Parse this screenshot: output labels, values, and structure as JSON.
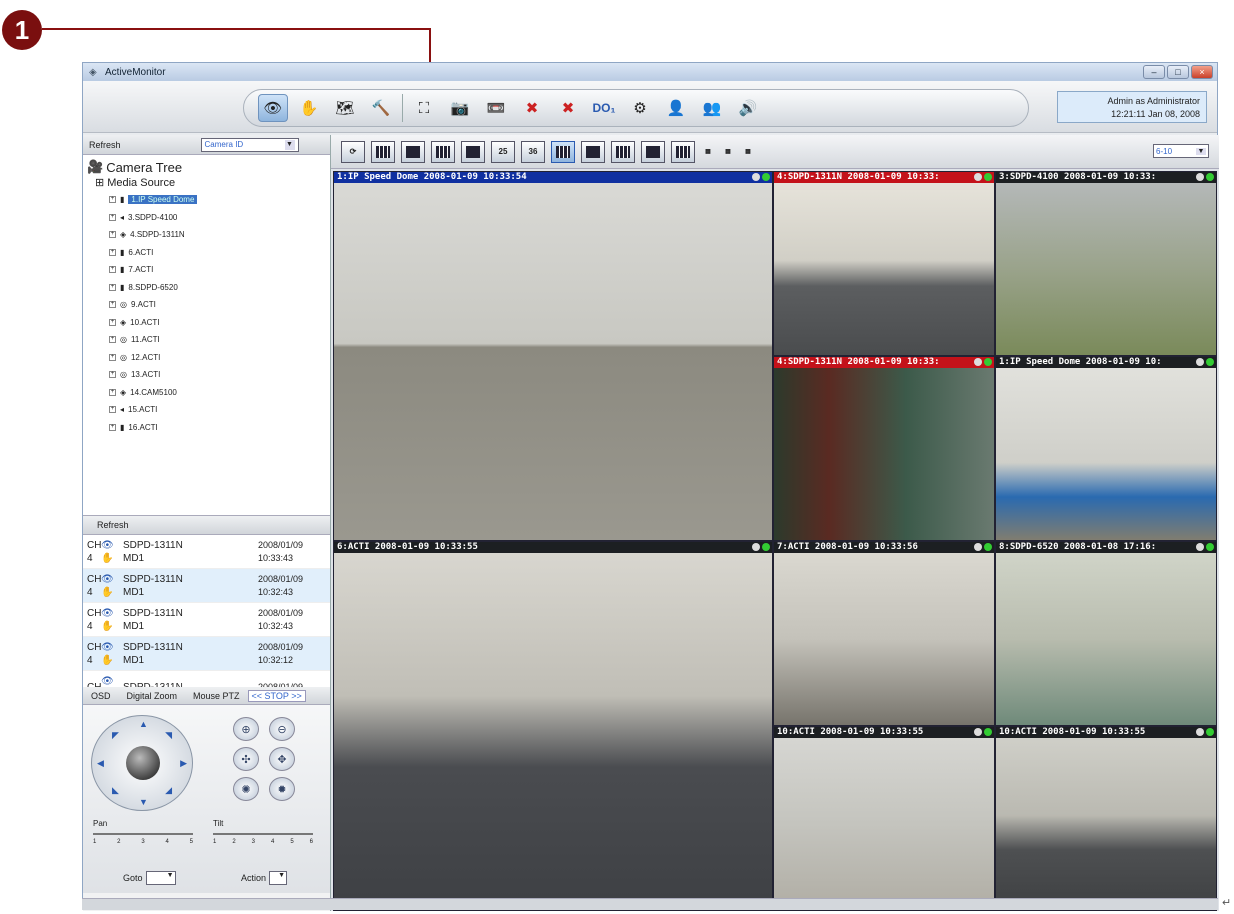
{
  "callout": {
    "number": "1"
  },
  "window": {
    "title": "ActiveMonitor",
    "controls": [
      "–",
      "□",
      "×"
    ]
  },
  "toolbar": {
    "buttons": [
      {
        "name": "eye-icon",
        "glyph": "👁",
        "active": true
      },
      {
        "name": "motion-detect-icon",
        "glyph": "✋"
      },
      {
        "name": "map-icon",
        "glyph": "🗺"
      },
      {
        "name": "tools-icon",
        "glyph": "🔨"
      },
      {
        "name": "fullscreen-icon",
        "glyph": "⛶"
      },
      {
        "name": "snapshot-icon",
        "glyph": "📷"
      },
      {
        "name": "record-icon",
        "glyph": "📼"
      },
      {
        "name": "disconnect-icon",
        "glyph": "✖"
      },
      {
        "name": "disconnect-all-icon",
        "glyph": "✖"
      },
      {
        "name": "do-icon",
        "glyph": "DO₁"
      },
      {
        "name": "settings-icon",
        "glyph": "⚙"
      },
      {
        "name": "user-icon",
        "glyph": "👤"
      },
      {
        "name": "users-icon",
        "glyph": "👥"
      },
      {
        "name": "volume-icon",
        "glyph": "🔊"
      }
    ],
    "admin_line1": "Admin as Administrator",
    "admin_line2": "12:21:11 Jan 08, 2008"
  },
  "left": {
    "refresh_label": "Refresh",
    "camera_select": "Camera ID",
    "tree_root": "Camera Tree",
    "media_source": "Media Source",
    "cameras": [
      "1.IP Speed Dome",
      "3.SDPD-4100",
      "4.SDPD-1311N",
      "6.ACTI",
      "7.ACTI",
      "8.SDPD-6520",
      "9.ACTI",
      "10.ACTI",
      "11.ACTI",
      "12.ACTI",
      "13.ACTI",
      "14.CAM5100",
      "15.ACTI",
      "16.ACTI"
    ],
    "events_refresh": "Refresh",
    "events": [
      {
        "ch": "CH",
        "num": "4",
        "device": "SDPD-1311N",
        "md": "MD1",
        "date": "2008/01/09",
        "time": "10:33:43"
      },
      {
        "ch": "CH",
        "num": "4",
        "device": "SDPD-1311N",
        "md": "MD1",
        "date": "2008/01/09",
        "time": "10:32:43"
      },
      {
        "ch": "CH",
        "num": "4",
        "device": "SDPD-1311N",
        "md": "MD1",
        "date": "2008/01/09",
        "time": "10:32:43"
      },
      {
        "ch": "CH",
        "num": "4",
        "device": "SDPD-1311N",
        "md": "MD1",
        "date": "2008/01/09",
        "time": "10:32:12"
      },
      {
        "ch": "CH",
        "num": "",
        "device": "SDPD-1311N",
        "md": "",
        "date": "2008/01/09",
        "time": ""
      }
    ],
    "ptz_tabs": [
      "OSD",
      "Digital Zoom",
      "Mouse PTZ",
      "<< STOP >>"
    ],
    "pan_label": "Pan",
    "tilt_label": "Tilt",
    "ticks": [
      "1",
      "2",
      "3",
      "4",
      "5"
    ],
    "tilt_ticks": [
      "1",
      "2",
      "3",
      "4",
      "5",
      "6"
    ],
    "goto_label": "Goto",
    "action_label": "Action"
  },
  "layoutbar": {
    "buttons": [
      "⟳",
      "",
      "",
      "",
      "",
      "25",
      "36",
      "",
      "",
      "",
      "",
      ""
    ],
    "page_select": "6-10"
  },
  "tiles": [
    {
      "caption": "1:IP Speed Dome  2008-01-09 10:33:54",
      "style": "blue"
    },
    {
      "caption": "4:SDPD-1311N  2008-01-09 10:33:",
      "style": "red"
    },
    {
      "caption": "3:SDPD-4100  2008-01-09 10:33:",
      "style": "dark"
    },
    {
      "caption": "4:SDPD-1311N  2008-01-09 10:33:",
      "style": "red"
    },
    {
      "caption": "1:IP Speed Dome  2008-01-09 10:",
      "style": "dark"
    },
    {
      "caption": "6:ACTI  2008-01-09 10:33:55",
      "style": "dark"
    },
    {
      "caption": "7:ACTI  2008-01-09 10:33:56",
      "style": "dark"
    },
    {
      "caption": "8:SDPD-6520  2008-01-08 17:16:",
      "style": "dark"
    },
    {
      "caption": "10:ACTI  2008-01-09 10:33:55",
      "style": "dark"
    },
    {
      "caption": "10:ACTI  2008-01-09 10:33:55",
      "style": "dark"
    }
  ]
}
